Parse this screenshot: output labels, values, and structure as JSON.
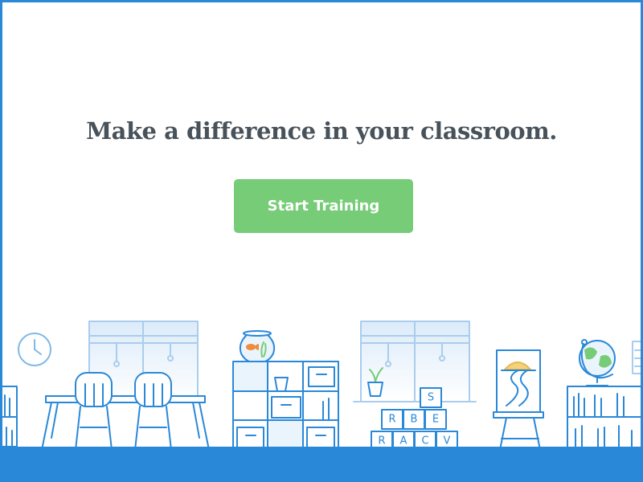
{
  "hero": {
    "headline": "Make a difference in your classroom.",
    "cta_label": "Start Training"
  },
  "illustration": {
    "letter_blocks": {
      "top": [
        "S"
      ],
      "middle": [
        "R",
        "B",
        "E"
      ],
      "bottom": [
        "R",
        "A",
        "C",
        "V"
      ]
    }
  },
  "colors": {
    "brand_blue": "#2a88d8",
    "cta_green": "#76cc77",
    "headline_text": "#48525b",
    "goldfish": "#f08a3c",
    "sun": "#f5d27a",
    "globe_land": "#76cc77"
  }
}
